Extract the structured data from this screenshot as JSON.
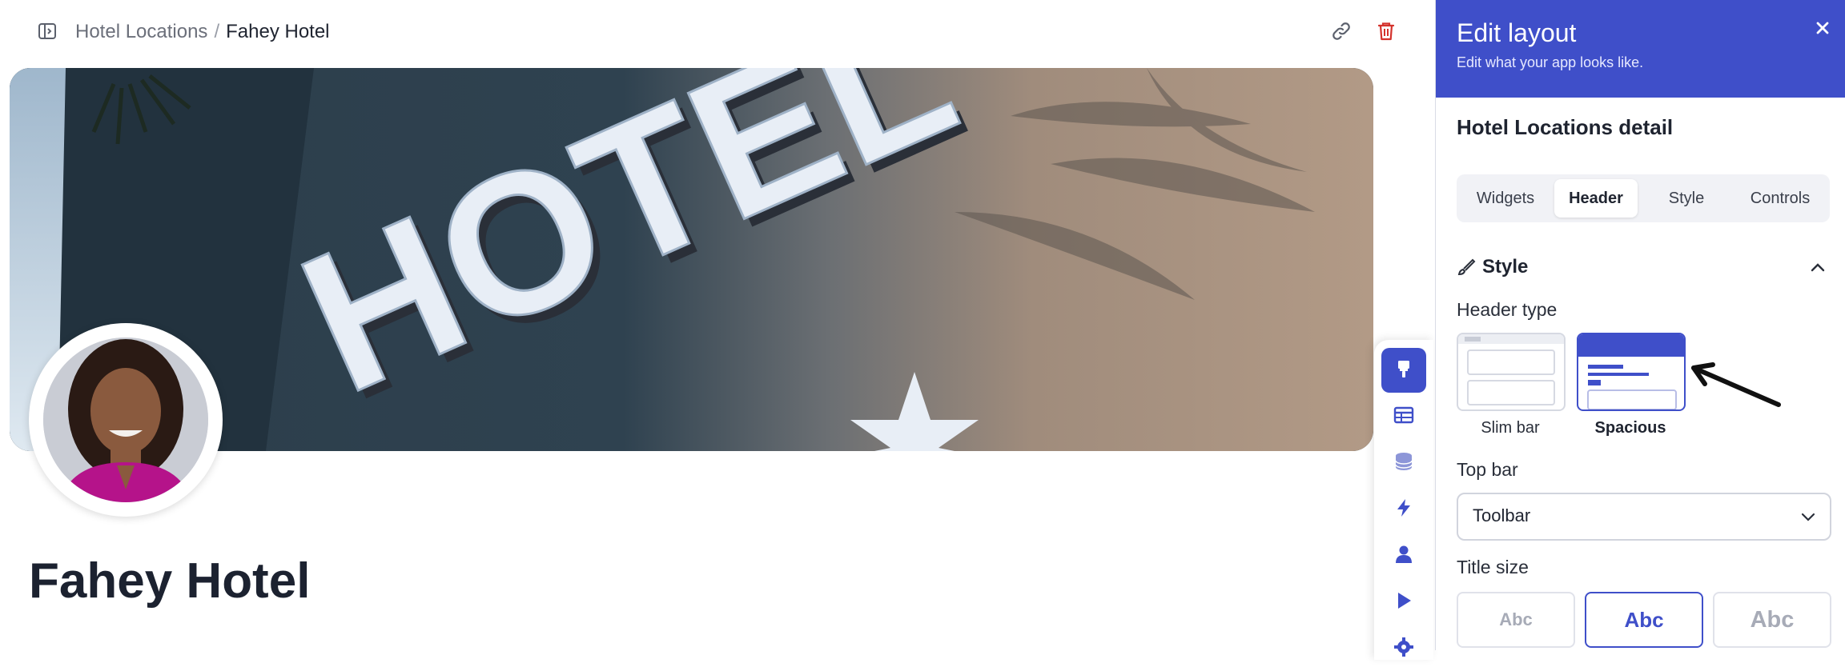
{
  "breadcrumb": {
    "parent": "Hotel Locations",
    "separator": "/",
    "current": "Fahey Hotel"
  },
  "cover": {
    "sign_text": "HOTEL"
  },
  "page_title": "Fahey Hotel",
  "panel": {
    "title": "Edit layout",
    "subtitle": "Edit what your app looks like.",
    "section_title": "Hotel Locations detail",
    "tabs": [
      {
        "label": "Widgets",
        "active": false
      },
      {
        "label": "Header",
        "active": true
      },
      {
        "label": "Style",
        "active": false
      },
      {
        "label": "Controls",
        "active": false
      }
    ],
    "style_group": "Style",
    "header_type_label": "Header type",
    "header_types": [
      {
        "label": "Slim bar",
        "selected": false
      },
      {
        "label": "Spacious",
        "selected": true
      }
    ],
    "top_bar_label": "Top bar",
    "top_bar_value": "Toolbar",
    "title_size_label": "Title size",
    "title_sizes": [
      {
        "label": "Abc",
        "selected": false
      },
      {
        "label": "Abc",
        "selected": true
      },
      {
        "label": "Abc",
        "selected": false
      }
    ]
  },
  "tool_rail": [
    "paintbrush-icon",
    "table-icon",
    "database-icon",
    "lightning-icon",
    "user-icon",
    "play-icon",
    "gear-icon"
  ],
  "colors": {
    "accent": "#3f4fc9",
    "danger": "#d4322c",
    "text": "#1f2430"
  }
}
